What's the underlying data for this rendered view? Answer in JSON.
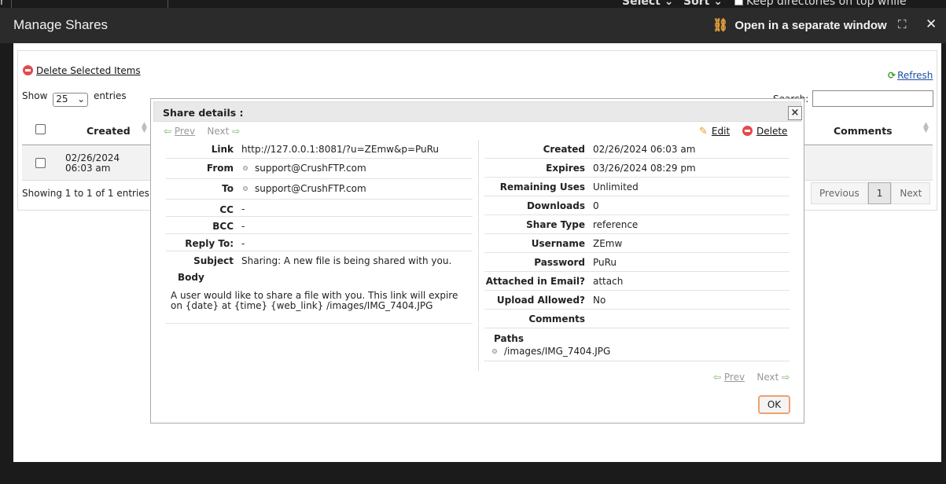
{
  "topbar": {
    "left_text": "r",
    "select_label": "Select",
    "sort_label": "Sort",
    "keep_dirs_label": "Keep directories on top while sorting"
  },
  "window": {
    "title": "Manage Shares",
    "open_separate_label": "Open in a separate window",
    "link_icon": "link-icon",
    "maximize_icon": "fullscreen-icon",
    "close_icon": "close-icon"
  },
  "list": {
    "delete_selected_label": "Delete Selected Items",
    "refresh_label": "Refresh",
    "show_label": "Show",
    "show_value": "25",
    "entries_label": "entries",
    "search_label": "Search:",
    "columns": {
      "created": "Created",
      "comments": "Comments"
    },
    "rows": [
      {
        "created": "02/26/2024 06:03 am"
      }
    ],
    "row_date": "02/26/2024",
    "row_time": "06:03 am",
    "showing_text": "Showing 1 to 1 of 1 entries",
    "pager": {
      "previous": "Previous",
      "current": "1",
      "next": "Next"
    }
  },
  "dialog": {
    "title": "Share details :",
    "nav": {
      "prev": "Prev",
      "next": "Next"
    },
    "edit_label": "Edit",
    "delete_label": "Delete",
    "left": {
      "link_label": "Link",
      "link_value": "http://127.0.0.1:8081/?u=ZEmw&p=PuRu",
      "from_label": "From",
      "from_value": "support@CrushFTP.com",
      "to_label": "To",
      "to_value": "support@CrushFTP.com",
      "cc_label": "CC",
      "cc_value": "-",
      "bcc_label": "BCC",
      "bcc_value": "-",
      "reply_label": "Reply To:",
      "reply_value": "-",
      "subject_label": "Subject",
      "subject_value": "Sharing: A new file is being shared with you.",
      "body_label": "Body",
      "body_value": "A user would like to share a file with you. This link will expire on {date} at {time} {web_link} /images/IMG_7404.JPG"
    },
    "right": {
      "created_label": "Created",
      "created_value": "02/26/2024 06:03 am",
      "expires_label": "Expires",
      "expires_value": "03/26/2024 08:29 pm",
      "remaining_label": "Remaining Uses",
      "remaining_value": "Unlimited",
      "downloads_label": "Downloads",
      "downloads_value": "0",
      "sharetype_label": "Share Type",
      "sharetype_value": "reference",
      "username_label": "Username",
      "username_value": "ZEmw",
      "password_label": "Password",
      "password_value": "PuRu",
      "attached_label": "Attached in Email?",
      "attached_value": "attach",
      "upload_label": "Upload Allowed?",
      "upload_value": "No",
      "comments_label": "Comments",
      "comments_value": "",
      "paths_label": "Paths",
      "paths_value": "/images/IMG_7404.JPG"
    },
    "ok_label": "OK"
  }
}
